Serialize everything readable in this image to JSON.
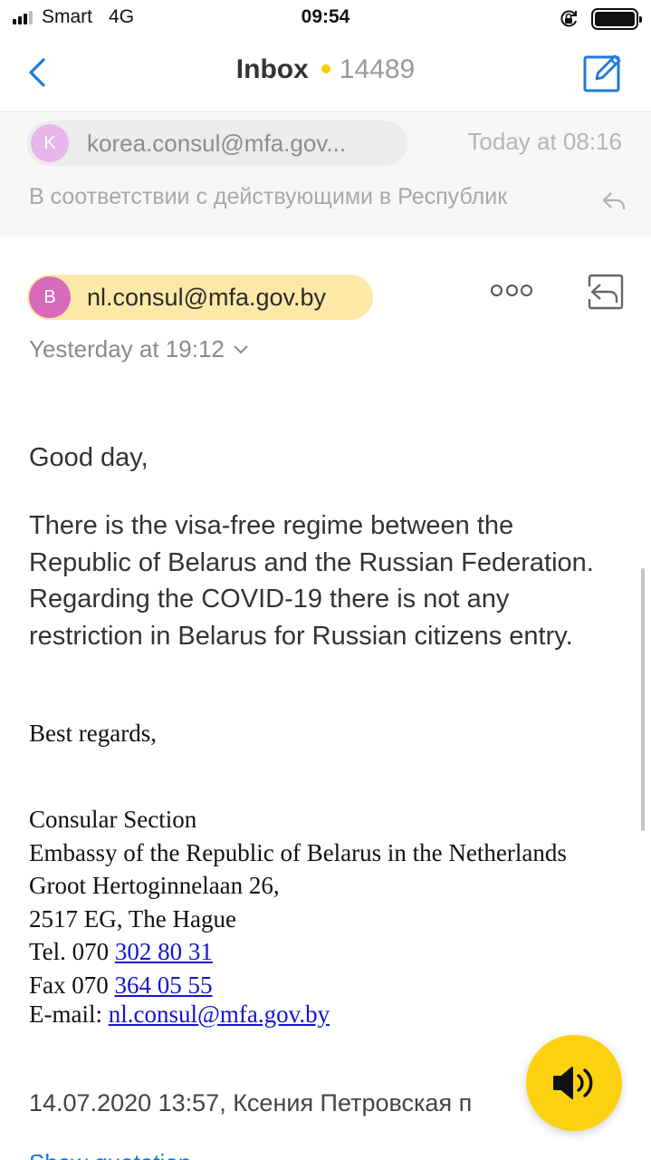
{
  "status_bar": {
    "carrier": "Smart",
    "network": "4G",
    "time": "09:54",
    "signal_bars_on": 3,
    "signal_bars_total": 4,
    "battery_level": 1.0,
    "lock_icon": "orientation-lock-icon"
  },
  "nav": {
    "back_icon": "chevron-left-icon",
    "title": "Inbox",
    "unread_count": "14489",
    "compose_icon": "compose-icon",
    "accent_color": "#1f7bd8",
    "unread_dot_color": "#f5d000"
  },
  "previous_message": {
    "avatar_letter": "K",
    "sender": "korea.consul@mfa.gov...",
    "time": "Today at 08:16",
    "snippet": "В соответствии с действующими в Республик"
  },
  "message": {
    "avatar_letter": "B",
    "sender": "nl.consul@mfa.gov.by",
    "date": "Yesterday at 19:12",
    "greeting": "Good day,",
    "body": "There is the visa-free regime between the Republic of Belarus and the Russian Federation. Regarding the COVID-19 there is not any restriction in Belarus for Russian citizens entry.",
    "regards": "Best regards,",
    "signature": {
      "line1": "Consular Section",
      "line2": "Embassy of the Republic of Belarus in the Netherlands",
      "line3": "Groot Hertoginnelaan 26,",
      "line4": "2517 EG, The Hague",
      "tel_label": "Tel. 070 ",
      "tel_link": "302 80 31",
      "fax_label": "Fax  070 ",
      "fax_link": "364 05 55",
      "email_label": "E-mail: ",
      "email_link": "nl.consul@mfa.gov.by"
    },
    "quote_header": "14.07.2020 13:57, Ксения Петровская п",
    "show_quotation": "Show quotation"
  },
  "floating_button": {
    "icon": "speaker-icon",
    "color": "#fcd210"
  }
}
